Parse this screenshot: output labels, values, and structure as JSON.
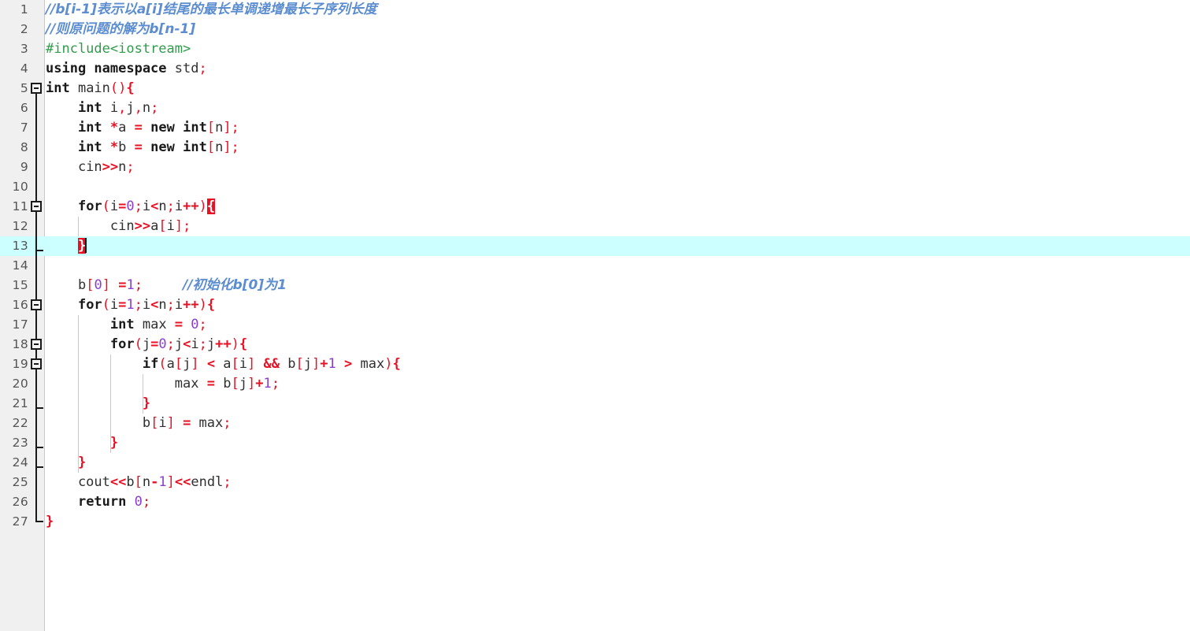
{
  "editor": {
    "name": "code-editor",
    "language": "C++",
    "colors": {
      "background": "#ffffff",
      "gutter_background": "#f0f0f0",
      "line_number": "#555555",
      "current_line_highlight": "#ccffff",
      "comment": "#5b8dd0",
      "preprocessor": "#2e9c4a",
      "keyword": "#1a1a1a",
      "operator": "#e81123",
      "punctuation": "#e81123",
      "number": "#8a3fd1",
      "plain": "#303030",
      "matching_brace_background": "#e81123",
      "matching_brace_text": "#ffffff",
      "fold_marker": "#1a1a1a",
      "indent_guide": "#c9c9c9"
    },
    "current_line": 13,
    "cursor": {
      "line": 13,
      "column": 6
    },
    "total_lines": 27,
    "lines": [
      {
        "n": "1",
        "fold": "none",
        "tokens": [
          {
            "c": "cmt",
            "t": "//b[i-1]表示以a[i]结尾的最长单调递增最长子序列长度"
          }
        ]
      },
      {
        "n": "2",
        "fold": "none",
        "tokens": [
          {
            "c": "cmt",
            "t": "//则原问题的解为b[n-1]"
          }
        ]
      },
      {
        "n": "3",
        "fold": "none",
        "tokens": [
          {
            "c": "pre",
            "t": "#include<iostream>"
          }
        ]
      },
      {
        "n": "4",
        "fold": "none",
        "tokens": [
          {
            "c": "kw",
            "t": "using namespace"
          },
          {
            "c": "pln",
            "t": " std"
          },
          {
            "c": "pun",
            "t": ";"
          }
        ]
      },
      {
        "n": "5",
        "fold": "box",
        "tokens": [
          {
            "c": "kw",
            "t": "int"
          },
          {
            "c": "pln",
            "t": " main"
          },
          {
            "c": "pun",
            "t": "()"
          },
          {
            "c": "op",
            "t": "{"
          }
        ]
      },
      {
        "n": "6",
        "fold": "line",
        "tokens": [
          {
            "c": "pln",
            "t": "    "
          },
          {
            "c": "kw",
            "t": "int"
          },
          {
            "c": "pln",
            "t": " i"
          },
          {
            "c": "pun",
            "t": ","
          },
          {
            "c": "pln",
            "t": "j"
          },
          {
            "c": "pun",
            "t": ","
          },
          {
            "c": "pln",
            "t": "n"
          },
          {
            "c": "pun",
            "t": ";"
          }
        ]
      },
      {
        "n": "7",
        "fold": "line",
        "tokens": [
          {
            "c": "pln",
            "t": "    "
          },
          {
            "c": "kw",
            "t": "int"
          },
          {
            "c": "pln",
            "t": " "
          },
          {
            "c": "op",
            "t": "*"
          },
          {
            "c": "pln",
            "t": "a "
          },
          {
            "c": "op",
            "t": "="
          },
          {
            "c": "pln",
            "t": " "
          },
          {
            "c": "kw",
            "t": "new int"
          },
          {
            "c": "pun",
            "t": "["
          },
          {
            "c": "pln",
            "t": "n"
          },
          {
            "c": "pun",
            "t": "];"
          }
        ]
      },
      {
        "n": "8",
        "fold": "line",
        "tokens": [
          {
            "c": "pln",
            "t": "    "
          },
          {
            "c": "kw",
            "t": "int"
          },
          {
            "c": "pln",
            "t": " "
          },
          {
            "c": "op",
            "t": "*"
          },
          {
            "c": "pln",
            "t": "b "
          },
          {
            "c": "op",
            "t": "="
          },
          {
            "c": "pln",
            "t": " "
          },
          {
            "c": "kw",
            "t": "new int"
          },
          {
            "c": "pun",
            "t": "["
          },
          {
            "c": "pln",
            "t": "n"
          },
          {
            "c": "pun",
            "t": "];"
          }
        ]
      },
      {
        "n": "9",
        "fold": "line",
        "tokens": [
          {
            "c": "pln",
            "t": "    cin"
          },
          {
            "c": "op",
            "t": ">>"
          },
          {
            "c": "pln",
            "t": "n"
          },
          {
            "c": "pun",
            "t": ";"
          }
        ]
      },
      {
        "n": "10",
        "fold": "line",
        "tokens": []
      },
      {
        "n": "11",
        "fold": "box",
        "tokens": [
          {
            "c": "pln",
            "t": "    "
          },
          {
            "c": "kw",
            "t": "for"
          },
          {
            "c": "pun",
            "t": "("
          },
          {
            "c": "pln",
            "t": "i"
          },
          {
            "c": "op",
            "t": "="
          },
          {
            "c": "num",
            "t": "0"
          },
          {
            "c": "pun",
            "t": ";"
          },
          {
            "c": "pln",
            "t": "i"
          },
          {
            "c": "op",
            "t": "<"
          },
          {
            "c": "pln",
            "t": "n"
          },
          {
            "c": "pun",
            "t": ";"
          },
          {
            "c": "pln",
            "t": "i"
          },
          {
            "c": "op",
            "t": "++"
          },
          {
            "c": "pun",
            "t": ")"
          },
          {
            "c": "brace-hl",
            "t": "{"
          }
        ]
      },
      {
        "n": "12",
        "fold": "line",
        "tokens": [
          {
            "c": "pln",
            "t": "        cin"
          },
          {
            "c": "op",
            "t": ">>"
          },
          {
            "c": "pln",
            "t": "a"
          },
          {
            "c": "pun",
            "t": "["
          },
          {
            "c": "pln",
            "t": "i"
          },
          {
            "c": "pun",
            "t": "];"
          }
        ]
      },
      {
        "n": "13",
        "fold": "tick",
        "tokens": [
          {
            "c": "pln",
            "t": "    "
          },
          {
            "c": "brace-hl",
            "t": "}"
          },
          {
            "c": "caret",
            "t": ""
          }
        ]
      },
      {
        "n": "14",
        "fold": "line",
        "tokens": []
      },
      {
        "n": "15",
        "fold": "line",
        "tokens": [
          {
            "c": "pln",
            "t": "    b"
          },
          {
            "c": "pun",
            "t": "["
          },
          {
            "c": "num",
            "t": "0"
          },
          {
            "c": "pun",
            "t": "]"
          },
          {
            "c": "pln",
            "t": " "
          },
          {
            "c": "op",
            "t": "="
          },
          {
            "c": "num",
            "t": "1"
          },
          {
            "c": "pun",
            "t": ";"
          },
          {
            "c": "pln",
            "t": "     "
          },
          {
            "c": "cmt",
            "t": "//初始化b[0]为1"
          }
        ]
      },
      {
        "n": "16",
        "fold": "box",
        "tokens": [
          {
            "c": "pln",
            "t": "    "
          },
          {
            "c": "kw",
            "t": "for"
          },
          {
            "c": "pun",
            "t": "("
          },
          {
            "c": "pln",
            "t": "i"
          },
          {
            "c": "op",
            "t": "="
          },
          {
            "c": "num",
            "t": "1"
          },
          {
            "c": "pun",
            "t": ";"
          },
          {
            "c": "pln",
            "t": "i"
          },
          {
            "c": "op",
            "t": "<"
          },
          {
            "c": "pln",
            "t": "n"
          },
          {
            "c": "pun",
            "t": ";"
          },
          {
            "c": "pln",
            "t": "i"
          },
          {
            "c": "op",
            "t": "++"
          },
          {
            "c": "pun",
            "t": ")"
          },
          {
            "c": "op",
            "t": "{"
          }
        ]
      },
      {
        "n": "17",
        "fold": "line",
        "tokens": [
          {
            "c": "pln",
            "t": "        "
          },
          {
            "c": "kw",
            "t": "int"
          },
          {
            "c": "pln",
            "t": " max "
          },
          {
            "c": "op",
            "t": "="
          },
          {
            "c": "pln",
            "t": " "
          },
          {
            "c": "num",
            "t": "0"
          },
          {
            "c": "pun",
            "t": ";"
          }
        ]
      },
      {
        "n": "18",
        "fold": "box",
        "tokens": [
          {
            "c": "pln",
            "t": "        "
          },
          {
            "c": "kw",
            "t": "for"
          },
          {
            "c": "pun",
            "t": "("
          },
          {
            "c": "pln",
            "t": "j"
          },
          {
            "c": "op",
            "t": "="
          },
          {
            "c": "num",
            "t": "0"
          },
          {
            "c": "pun",
            "t": ";"
          },
          {
            "c": "pln",
            "t": "j"
          },
          {
            "c": "op",
            "t": "<"
          },
          {
            "c": "pln",
            "t": "i"
          },
          {
            "c": "pun",
            "t": ";"
          },
          {
            "c": "pln",
            "t": "j"
          },
          {
            "c": "op",
            "t": "++"
          },
          {
            "c": "pun",
            "t": ")"
          },
          {
            "c": "op",
            "t": "{"
          }
        ]
      },
      {
        "n": "19",
        "fold": "box",
        "tokens": [
          {
            "c": "pln",
            "t": "            "
          },
          {
            "c": "kw",
            "t": "if"
          },
          {
            "c": "pun",
            "t": "("
          },
          {
            "c": "pln",
            "t": "a"
          },
          {
            "c": "pun",
            "t": "["
          },
          {
            "c": "pln",
            "t": "j"
          },
          {
            "c": "pun",
            "t": "]"
          },
          {
            "c": "pln",
            "t": " "
          },
          {
            "c": "op",
            "t": "<"
          },
          {
            "c": "pln",
            "t": " a"
          },
          {
            "c": "pun",
            "t": "["
          },
          {
            "c": "pln",
            "t": "i"
          },
          {
            "c": "pun",
            "t": "]"
          },
          {
            "c": "pln",
            "t": " "
          },
          {
            "c": "op",
            "t": "&&"
          },
          {
            "c": "pln",
            "t": " b"
          },
          {
            "c": "pun",
            "t": "["
          },
          {
            "c": "pln",
            "t": "j"
          },
          {
            "c": "pun",
            "t": "]"
          },
          {
            "c": "op",
            "t": "+"
          },
          {
            "c": "num",
            "t": "1"
          },
          {
            "c": "pln",
            "t": " "
          },
          {
            "c": "op",
            "t": ">"
          },
          {
            "c": "pln",
            "t": " max"
          },
          {
            "c": "pun",
            "t": ")"
          },
          {
            "c": "op",
            "t": "{"
          }
        ]
      },
      {
        "n": "20",
        "fold": "line",
        "tokens": [
          {
            "c": "pln",
            "t": "                max "
          },
          {
            "c": "op",
            "t": "="
          },
          {
            "c": "pln",
            "t": " b"
          },
          {
            "c": "pun",
            "t": "["
          },
          {
            "c": "pln",
            "t": "j"
          },
          {
            "c": "pun",
            "t": "]"
          },
          {
            "c": "op",
            "t": "+"
          },
          {
            "c": "num",
            "t": "1"
          },
          {
            "c": "pun",
            "t": ";"
          }
        ]
      },
      {
        "n": "21",
        "fold": "tick",
        "tokens": [
          {
            "c": "pln",
            "t": "            "
          },
          {
            "c": "op",
            "t": "}"
          }
        ]
      },
      {
        "n": "22",
        "fold": "line",
        "tokens": [
          {
            "c": "pln",
            "t": "            b"
          },
          {
            "c": "pun",
            "t": "["
          },
          {
            "c": "pln",
            "t": "i"
          },
          {
            "c": "pun",
            "t": "]"
          },
          {
            "c": "pln",
            "t": " "
          },
          {
            "c": "op",
            "t": "="
          },
          {
            "c": "pln",
            "t": " max"
          },
          {
            "c": "pun",
            "t": ";"
          }
        ]
      },
      {
        "n": "23",
        "fold": "tick",
        "tokens": [
          {
            "c": "pln",
            "t": "        "
          },
          {
            "c": "op",
            "t": "}"
          }
        ]
      },
      {
        "n": "24",
        "fold": "tick",
        "tokens": [
          {
            "c": "pln",
            "t": "    "
          },
          {
            "c": "op",
            "t": "}"
          }
        ]
      },
      {
        "n": "25",
        "fold": "line",
        "tokens": [
          {
            "c": "pln",
            "t": "    cout"
          },
          {
            "c": "op",
            "t": "<<"
          },
          {
            "c": "pln",
            "t": "b"
          },
          {
            "c": "pun",
            "t": "["
          },
          {
            "c": "pln",
            "t": "n"
          },
          {
            "c": "op",
            "t": "-"
          },
          {
            "c": "num",
            "t": "1"
          },
          {
            "c": "pun",
            "t": "]"
          },
          {
            "c": "op",
            "t": "<<"
          },
          {
            "c": "pln",
            "t": "endl"
          },
          {
            "c": "pun",
            "t": ";"
          }
        ]
      },
      {
        "n": "26",
        "fold": "line",
        "tokens": [
          {
            "c": "pln",
            "t": "    "
          },
          {
            "c": "kw",
            "t": "return"
          },
          {
            "c": "pln",
            "t": " "
          },
          {
            "c": "num",
            "t": "0"
          },
          {
            "c": "pun",
            "t": ";"
          }
        ]
      },
      {
        "n": "27",
        "fold": "corner",
        "tokens": [
          {
            "c": "op",
            "t": "}"
          }
        ]
      }
    ],
    "indent_guides": [
      {
        "line": 12,
        "columns": [
          1
        ]
      },
      {
        "line": 17,
        "columns": [
          1
        ]
      },
      {
        "line": 18,
        "columns": [
          1
        ]
      },
      {
        "line": 19,
        "columns": [
          1,
          2
        ]
      },
      {
        "line": 20,
        "columns": [
          1,
          2,
          3
        ]
      },
      {
        "line": 21,
        "columns": [
          1,
          2,
          3
        ]
      },
      {
        "line": 22,
        "columns": [
          1,
          2
        ]
      },
      {
        "line": 23,
        "columns": [
          1,
          2
        ]
      },
      {
        "line": 24,
        "columns": [
          1
        ]
      }
    ]
  }
}
